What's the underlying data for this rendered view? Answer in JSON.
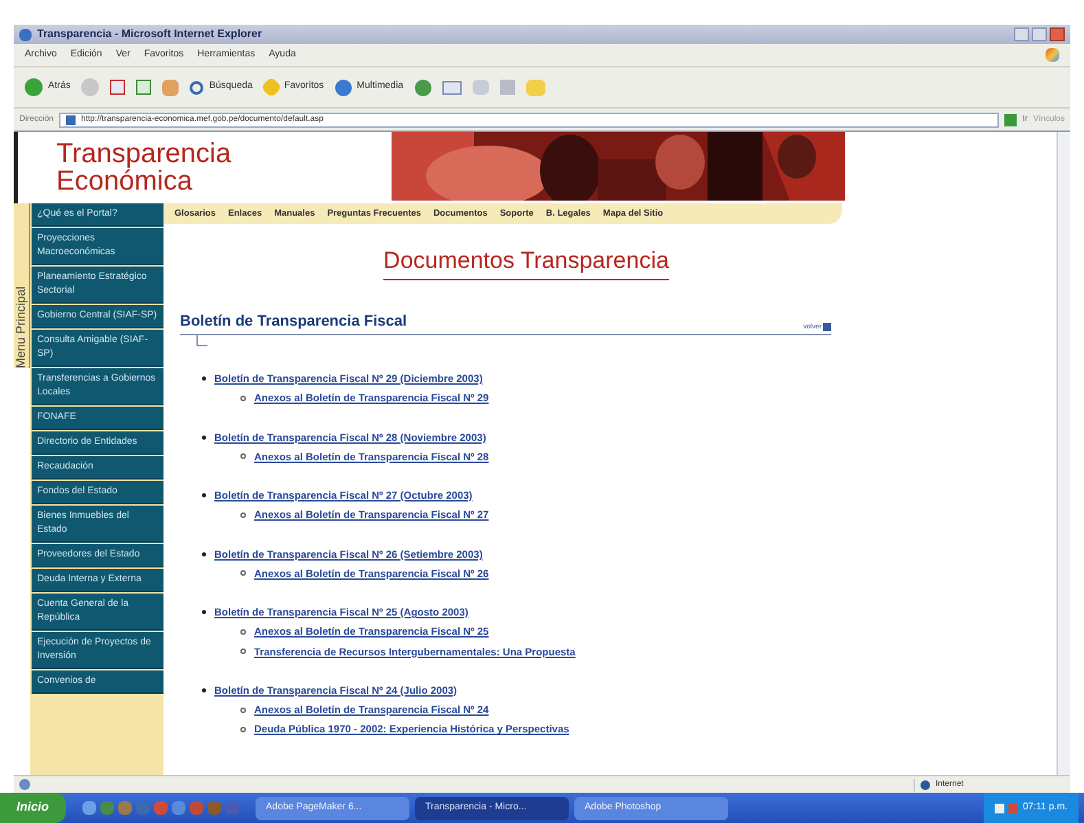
{
  "window": {
    "title": "Transparencia - Microsoft Internet Explorer"
  },
  "menu": [
    "Archivo",
    "Edición",
    "Ver",
    "Favoritos",
    "Herramientas",
    "Ayuda"
  ],
  "toolbar": {
    "back": "Atrás",
    "search": "Búsqueda",
    "favorites": "Favoritos",
    "media": "Multimedia"
  },
  "address": {
    "label": "Dirección",
    "value": "http://transparencia-economica.mef.gob.pe/documento/default.asp",
    "go": "Ir",
    "links": "Vínculos"
  },
  "site": {
    "logo_line1": "Transparencia",
    "logo_line2": "Económica",
    "side_tab": "Menu Principal",
    "sidebar": [
      "¿Qué es el Portal?",
      "Proyecciones Macroeconómicas",
      "Planeamiento Estratégico Sectorial",
      "Gobierno Central (SIAF-SP)",
      "Consulta Amigable (SIAF-SP)",
      "Transferencias a Gobiernos Locales",
      "FONAFE",
      "Directorio de Entidades",
      "Recaudación",
      "Fondos del Estado",
      "Bienes Inmuebles del Estado",
      "Proveedores del Estado",
      "Deuda Interna y Externa",
      "Cuenta General de la República",
      "Ejecución de Proyectos de Inversión",
      "Convenios de"
    ],
    "nav": [
      "Glosarios",
      "Enlaces",
      "Manuales",
      "Preguntas Frecuentes",
      "Documentos",
      "Soporte",
      "B. Legales",
      "Mapa del Sitio"
    ],
    "page_title": "Documentos Transparencia",
    "section_title": "Boletín de Transparencia Fiscal",
    "back_link": "volver",
    "bulletins": [
      {
        "title": "Boletín de Transparencia Fiscal Nº 29 (Diciembre 2003)",
        "children": [
          "Anexos al Boletín de Transparencia Fiscal Nº 29"
        ]
      },
      {
        "title": "Boletín de Transparencia Fiscal Nº 28 (Noviembre 2003)",
        "children": [
          "Anexos al Boletín de Transparencia Fiscal Nº 28"
        ]
      },
      {
        "title": "Boletín de Transparencia Fiscal Nº 27 (Octubre 2003)",
        "children": [
          "Anexos al Boletín de Transparencia Fiscal Nº 27"
        ]
      },
      {
        "title": "Boletín de Transparencia Fiscal Nº 26 (Setiembre 2003)",
        "children": [
          "Anexos al Boletín de Transparencia Fiscal Nº 26"
        ]
      },
      {
        "title": "Boletín de Transparencia Fiscal Nº 25 (Agosto 2003)",
        "children": [
          "Anexos al Boletín de Transparencia Fiscal Nº 25",
          "Transferencia de Recursos Intergubernamentales: Una Propuesta"
        ]
      },
      {
        "title": "Boletín de Transparencia Fiscal Nº 24 (Julio 2003)",
        "children": [
          "Anexos al Boletín de Transparencia Fiscal Nº 24",
          "Deuda Pública 1970 - 2002: Experiencia Histórica y Perspectivas"
        ]
      }
    ]
  },
  "status_bar": {
    "zone": "Internet"
  },
  "taskbar": {
    "start": "Inicio",
    "tasks": [
      {
        "label": "Adobe PageMaker 6...",
        "selected": false
      },
      {
        "label": "Transparencia - Micro...",
        "selected": true
      },
      {
        "label": "Adobe Photoshop",
        "selected": false
      }
    ],
    "clock": "07:11 p.m."
  }
}
